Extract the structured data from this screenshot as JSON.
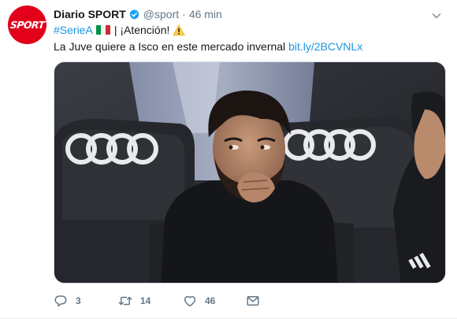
{
  "tweet": {
    "avatar_text": "SPORT",
    "display_name": "Diario SPORT",
    "handle": "@sport",
    "separator": "·",
    "time": "46 min",
    "hashtag": "#SerieA",
    "line1_rest": "| ¡Atención!",
    "text": "La Juve quiere a Isco en este mercado invernal",
    "link": "bit.ly/2BCVNLx",
    "icons": {
      "verified": "verified-badge-icon",
      "flag": "italy-flag-icon",
      "warning": "warning-sign-icon",
      "caret": "chevron-down-icon"
    }
  },
  "actions": {
    "reply_count": "3",
    "retweet_count": "14",
    "like_count": "46",
    "icons": [
      "reply-icon",
      "retweet-icon",
      "like-icon",
      "direct-message-icon"
    ]
  },
  "colors": {
    "brand_red": "#e2001a",
    "link_blue": "#1b95e0",
    "text": "#14171a",
    "secondary": "#657786",
    "verified": "#1da1f2",
    "flag": [
      "#009246",
      "#ffffff",
      "#ce2b37"
    ]
  }
}
